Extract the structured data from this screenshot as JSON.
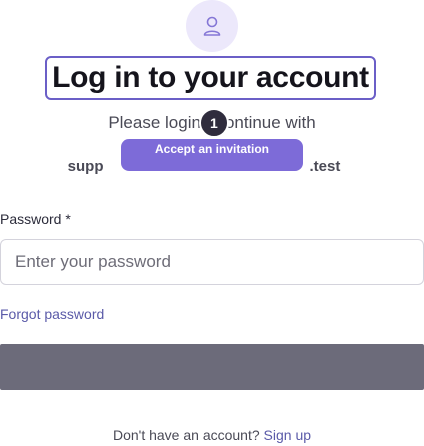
{
  "icons": {
    "avatar": "user-icon"
  },
  "colors": {
    "accent": "#6b5fc7",
    "tooltip_bg": "#7d6bd8",
    "submit_bg": "#6c6b7a",
    "link": "#5a5aa8"
  },
  "header": {
    "title": "Log in to your account",
    "subtitle_before": "Please login ",
    "subtitle_after": "ontinue with",
    "step_number": "1",
    "email_prefix": "supp",
    "email_suffix": ".test"
  },
  "tooltip": {
    "label": "Accept an invitation"
  },
  "form": {
    "password_label": "Password",
    "required_marker": "*",
    "password_placeholder": "Enter your password",
    "password_value": "",
    "forgot_password": "Forgot password"
  },
  "footer": {
    "signup_prompt": "Don't have an account?",
    "signup_link": "Sign up"
  }
}
